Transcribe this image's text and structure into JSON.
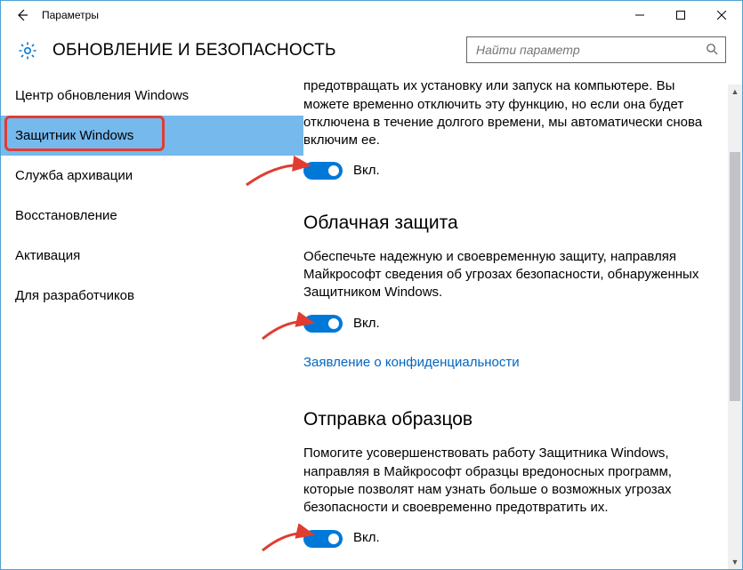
{
  "titlebar": {
    "title": "Параметры"
  },
  "header": {
    "page_title": "ОБНОВЛЕНИЕ И БЕЗОПАСНОСТЬ"
  },
  "search": {
    "placeholder": "Найти параметр"
  },
  "sidebar": {
    "items": [
      {
        "label": "Центр обновления Windows"
      },
      {
        "label": "Защитник Windows"
      },
      {
        "label": "Служба архивации"
      },
      {
        "label": "Восстановление"
      },
      {
        "label": "Активация"
      },
      {
        "label": "Для разработчиков"
      }
    ]
  },
  "content": {
    "realtime": {
      "desc": "Это помогает обнаруживать вредоносные программы и предотвращать их установку или запуск на компьютере. Вы можете временно отключить эту функцию, но если она будет отключена в течение долгого времени, мы автоматически снова включим ее.",
      "state": "Вкл."
    },
    "cloud": {
      "heading": "Облачная защита",
      "desc": "Обеспечьте надежную и своевременную защиту, направляя Майкрософт сведения об угрозах безопасности, обнаруженных Защитником Windows.",
      "state": "Вкл.",
      "privacy_link": "Заявление о конфиденциальности"
    },
    "sample": {
      "heading": "Отправка образцов",
      "desc": "Помогите усовершенствовать работу Защитника Windows, направляя в Майкрософт образцы вредоносных программ, которые позволят нам узнать больше о возможных угрозах безопасности и своевременно предотвратить их.",
      "state": "Вкл."
    }
  }
}
